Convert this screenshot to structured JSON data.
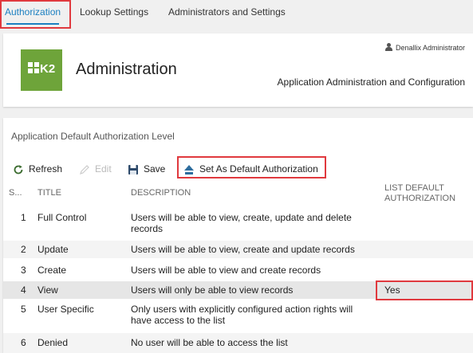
{
  "tabs": [
    {
      "label": "Authorization"
    },
    {
      "label": "Lookup Settings"
    },
    {
      "label": "Administrators and Settings"
    }
  ],
  "header": {
    "logo_text": "K2",
    "title": "Administration",
    "user": "Denallix Administrator",
    "subtitle": "Application Administration and Configuration"
  },
  "panel": {
    "title": "Application Default Authorization Level"
  },
  "toolbar": {
    "refresh": "Refresh",
    "edit": "Edit",
    "save": "Save",
    "set_default": "Set As Default Authorization"
  },
  "table": {
    "columns": [
      "S...",
      "TITLE",
      "DESCRIPTION",
      "LIST DEFAULT AUTHORIZATION"
    ],
    "rows": [
      {
        "seq": "1",
        "title": "Full Control",
        "description": "Users will be able to view, create, update and delete records",
        "default": ""
      },
      {
        "seq": "2",
        "title": "Update",
        "description": "Users will be able to view, create and update records",
        "default": ""
      },
      {
        "seq": "3",
        "title": "Create",
        "description": "Users will be able to view and create records",
        "default": ""
      },
      {
        "seq": "4",
        "title": "View",
        "description": "Users will only be able to view records",
        "default": "Yes"
      },
      {
        "seq": "5",
        "title": "User Specific",
        "description": "Only users with explicitly configured action rights will have access to the list",
        "default": ""
      },
      {
        "seq": "6",
        "title": "Denied",
        "description": "No user will be able to access the list",
        "default": ""
      }
    ]
  },
  "colors": {
    "accent": "#1a7fc1",
    "highlight_box": "#e0393e",
    "logo_green": "#6ea43a"
  },
  "icons": [
    "refresh-icon",
    "edit-icon",
    "save-icon",
    "upload-icon",
    "user-icon",
    "k2-logo"
  ]
}
